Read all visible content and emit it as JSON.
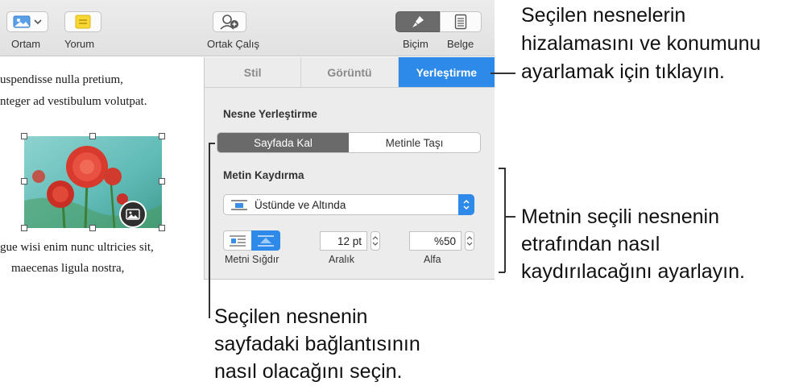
{
  "toolbar": {
    "media_label": "Ortam",
    "comment_label": "Yorum",
    "collaborate_label": "Ortak Çalış",
    "format_label": "Biçim",
    "document_label": "Belge"
  },
  "document": {
    "lines_top": [
      "uspendisse nulla pretium,",
      "nteger ad vestibulum volutpat."
    ],
    "lines_bottom": [
      "gue wisi enim nunc ultricies sit,",
      "maecenas ligula nostra,"
    ]
  },
  "inspector": {
    "tabs": [
      "Stil",
      "Görüntü",
      "Yerleştirme"
    ],
    "active_tab": "Yerleştirme",
    "object_placement_title": "Nesne Yerleştirme",
    "placement_options": [
      "Sayfada Kal",
      "Metinle Taşı"
    ],
    "selected_placement": "Sayfada Kal",
    "text_wrap_title": "Metin Kaydırma",
    "wrap_style_value": "Üstünde ve Altında",
    "fit_text_label": "Metni Sığdır",
    "spacing_label": "Aralık",
    "spacing_value": "12 pt",
    "alpha_label": "Alfa",
    "alpha_value": "%50"
  },
  "callouts": {
    "top_right": [
      "Seçilen nesnelerin",
      "hizalamasını ve konumunu",
      "ayarlamak için tıklayın."
    ],
    "middle_right": [
      "Metnin seçili nesnenin",
      "etrafından nasıl",
      "kaydırılacağını ayarlayın."
    ],
    "bottom": [
      "Seçilen nesnenin",
      "sayfadaki bağlantısının",
      "nasıl olacağını seçin."
    ]
  },
  "colors": {
    "accent": "#2d8ae8",
    "segment_selected": "#6a6a6a",
    "panel_bg": "#ececec",
    "comment_yellow": "#f7d731"
  }
}
